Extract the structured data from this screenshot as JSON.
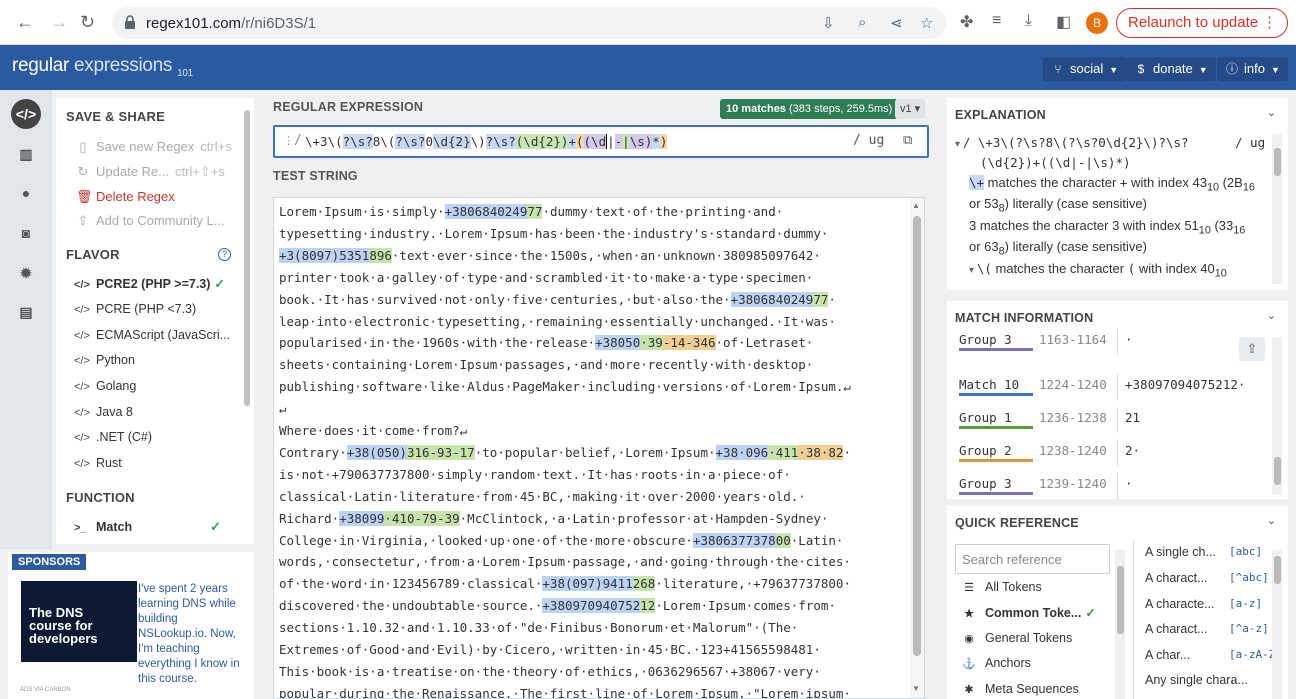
{
  "browser": {
    "url_host": "regex101.com",
    "url_path": "/r/ni6D3S/1",
    "avatar_letter": "B",
    "relaunch_label": "Relaunch to update",
    "relaunch_menu": "⋮"
  },
  "header": {
    "logo_a": "regular",
    "logo_b": " expressions",
    "logo_c": "101",
    "social": "social",
    "donate": "donate",
    "info": "info"
  },
  "save_share": {
    "title": "SAVE & SHARE",
    "save_new": "Save new Regex",
    "save_new_key": "ctrl+s",
    "update": "Update Re...",
    "update_key": "ctrl+⇧+s",
    "delete": "Delete Regex",
    "community": "Add to Community L..."
  },
  "flavor": {
    "title": "FLAVOR",
    "items": [
      "PCRE2 (PHP >=7.3)",
      "PCRE (PHP <7.3)",
      "ECMAScript (JavaScri...",
      "Python",
      "Golang",
      "Java 8",
      ".NET (C#)",
      "Rust"
    ]
  },
  "function": {
    "title": "FUNCTION",
    "match": "Match"
  },
  "sponsors": {
    "label": "SPONSORS",
    "ad_title": "The DNS course for developers",
    "ad_text": "I've spent 2 years learning DNS while building NSLookup.io. Now, I'm teaching everything I know in this course.",
    "ads_via": "ADS VIA CARBON"
  },
  "regex": {
    "label": "REGULAR EXPRESSION",
    "matches_bold": "10 matches",
    "matches_rest": " (383 steps, 259.5ms)",
    "version": "v1",
    "delimiter": "/",
    "flags": "/ ug",
    "parts": [
      "\\+3\\(",
      "?\\s?",
      "8\\(",
      "?\\s?",
      "0",
      "\\d{2}",
      "\\)",
      "?\\s?",
      "(\\d{2})",
      "+",
      "(",
      "(\\d",
      "|",
      "-",
      "|",
      "\\s",
      ")",
      "*",
      ")"
    ]
  },
  "test_string": {
    "label": "TEST STRING",
    "lines": [
      [
        [
          "Lorem·Ipsum·is·simply·",
          ""
        ],
        [
          "+3806840249",
          "m1"
        ],
        [
          "77",
          "m2"
        ],
        [
          "·dummy·text·of·the·printing·and·",
          ""
        ]
      ],
      [
        [
          "typesetting·industry.·Lorem·Ipsum·has·been·the·industry's·standard·dummy·",
          ""
        ]
      ],
      [
        [
          "+3(8097)5351",
          "m1"
        ],
        [
          "896",
          "m2"
        ],
        [
          "·text·ever·since·the·1500s,·when·an·unknown·380985097642·",
          ""
        ]
      ],
      [
        [
          "printer·took·a·galley·of·type·and·scrambled·it·to·make·a·type·specimen·",
          ""
        ]
      ],
      [
        [
          "book.·It·has·survived·not·only·five·centuries,·but·also·the·",
          ""
        ],
        [
          "+3806840249",
          "m1"
        ],
        [
          "77",
          "m2"
        ],
        [
          "·",
          ""
        ]
      ],
      [
        [
          "leap·into·electronic·typesetting,·remaining·essentially·unchanged.·It·was·",
          ""
        ]
      ],
      [
        [
          "popularised·in·the·1960s·with·the·release·",
          ""
        ],
        [
          "+38050",
          "m1"
        ],
        [
          "·39",
          "m2"
        ],
        [
          "-14-346",
          "m3"
        ],
        [
          "·of·Letraset·",
          ""
        ]
      ],
      [
        [
          "sheets·containing·Lorem·Ipsum·passages,·and·more·recently·with·desktop·",
          ""
        ]
      ],
      [
        [
          "publishing·software·like·Aldus·PageMaker·including·versions·of·Lorem·Ipsum.↵",
          ""
        ]
      ],
      [
        [
          "↵",
          ""
        ]
      ],
      [
        [
          "Where·does·it·come·from?↵",
          ""
        ]
      ],
      [
        [
          "Contrary·",
          ""
        ],
        [
          "+38(050)",
          "m1"
        ],
        [
          "316-93-17",
          "m2"
        ],
        [
          "·to·popular·belief,·Lorem·Ipsum·",
          ""
        ],
        [
          "+38·096",
          "m1"
        ],
        [
          "·411",
          "m2"
        ],
        [
          "·38·82",
          "m3"
        ],
        [
          "·",
          ""
        ]
      ],
      [
        [
          "is·not·+790637737800·simply·random·text.·It·has·roots·in·a·piece·of·",
          ""
        ]
      ],
      [
        [
          "classical·Latin·literature·from·45·BC,·making·it·over·2000·years·old.·",
          ""
        ]
      ],
      [
        [
          "Richard·",
          ""
        ],
        [
          "+38099",
          "m1"
        ],
        [
          "·410-79-39",
          "m2"
        ],
        [
          "·McClintock,·a·Latin·professor·at·Hampden-Sydney·",
          ""
        ]
      ],
      [
        [
          "College·in·Virginia,·looked·up·one·of·the·more·obscure·",
          ""
        ],
        [
          "+3806377378",
          "m1"
        ],
        [
          "00",
          "m2"
        ],
        [
          "·Latin·",
          ""
        ]
      ],
      [
        [
          "words,·consectetur,·from·a·Lorem·Ipsum·passage,·and·going·through·the·cites·",
          ""
        ]
      ],
      [
        [
          "of·the·word·in·123456789·classical·",
          ""
        ],
        [
          "+38(097)9411",
          "m1"
        ],
        [
          "268",
          "m2"
        ],
        [
          "·literature,·+79637737800·",
          ""
        ]
      ],
      [
        [
          "discovered·the·undoubtable·source.·",
          ""
        ],
        [
          "+380970940752",
          "m1"
        ],
        [
          "12",
          "m2"
        ],
        [
          "·Lorem·Ipsum·comes·from·",
          ""
        ]
      ],
      [
        [
          "sections·1.10.32·and·1.10.33·of·\"de·Finibus·Bonorum·et·Malorum\"·(The·",
          ""
        ]
      ],
      [
        [
          "Extremes·of·Good·and·Evil)·by·Cicero,·written·in·45·BC.·123+41565598481·",
          ""
        ]
      ],
      [
        [
          "This·book·is·a·treatise·on·the·theory·of·ethics,·0636296567·+38067·very·",
          ""
        ]
      ],
      [
        [
          "popular·during·the·Renaissance.·The·first·line·of·Lorem·Ipsum,·\"Lorem·ipsum·",
          ""
        ]
      ]
    ]
  },
  "explanation": {
    "title": "EXPLANATION",
    "regex_line1": "/ \\+3\\(?\\s?8\\(?\\s?0\\d{2}\\)?\\s?",
    "regex_flags": "/ ug",
    "regex_line2": "(\\d{2})+((\\d|-|\\s)*)",
    "l1_tok": "\\+",
    "l1_text": " matches the character ",
    "l1_char": "+",
    "l1_rest": " with index 43",
    "l1_sub": "10",
    "l1_rest2": " (2B",
    "l1_sub2": "16",
    "l2_text": "or 53",
    "l2_sub": "8",
    "l2_rest": ") literally (case sensitive)",
    "l3_text": "3 matches the character 3 with index 51",
    "l3_sub": "10",
    "l3_rest": " (33",
    "l3_sub2": "16",
    "l4_text": "or 63",
    "l4_sub": "8",
    "l4_rest": ") literally (case sensitive)",
    "l5_tok": "\\(",
    "l5_text": " matches the character ",
    "l5_char": "(",
    "l5_rest": " with index 40",
    "l5_sub": "10"
  },
  "match_info": {
    "title": "MATCH INFORMATION",
    "rows": [
      {
        "name": "Group 3",
        "range": "1163-1164",
        "value": "·"
      },
      {
        "name": "Match 10",
        "range": "1224-1240",
        "value": "+38097094075212·"
      },
      {
        "name": "Group 1",
        "range": "1236-1238",
        "value": "21"
      },
      {
        "name": "Group 2",
        "range": "1238-1240",
        "value": "2·"
      },
      {
        "name": "Group 3",
        "range": "1239-1240",
        "value": "·"
      }
    ]
  },
  "quick_ref": {
    "title": "QUICK REFERENCE",
    "search_placeholder": "Search reference",
    "categories": [
      "All Tokens",
      "Common Toke...",
      "General Tokens",
      "Anchors",
      "Meta Sequences"
    ],
    "tokens": [
      {
        "label": "A single ch...",
        "code": "[abc]"
      },
      {
        "label": "A charact...",
        "code": "[^abc]"
      },
      {
        "label": "A characte...",
        "code": "[a-z]"
      },
      {
        "label": "A charact...",
        "code": "[^a-z]"
      },
      {
        "label": "A char...",
        "code": "[a-zA-Z]"
      },
      {
        "label": "Any single chara...",
        "code": "."
      }
    ]
  }
}
